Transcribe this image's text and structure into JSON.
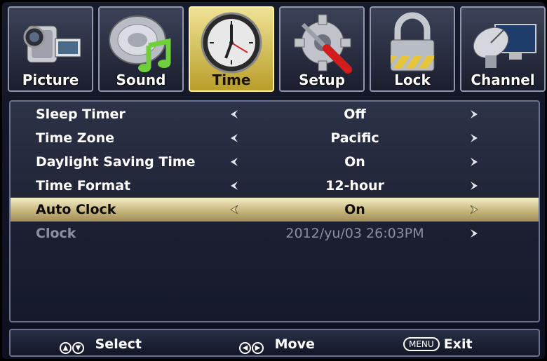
{
  "tabs": [
    {
      "label": "Picture",
      "icon": "camcorder-icon",
      "active": false
    },
    {
      "label": "Sound",
      "icon": "speaker-note-icon",
      "active": false
    },
    {
      "label": "Time",
      "icon": "clock-icon",
      "active": true
    },
    {
      "label": "Setup",
      "icon": "gear-wrench-icon",
      "active": false
    },
    {
      "label": "Lock",
      "icon": "padlock-icon",
      "active": false
    },
    {
      "label": "Channel",
      "icon": "satellite-dish-icon",
      "active": false
    }
  ],
  "menu": {
    "rows": [
      {
        "label": "Sleep Timer",
        "value": "Off",
        "state": "normal"
      },
      {
        "label": "Time Zone",
        "value": "Pacific",
        "state": "normal"
      },
      {
        "label": "Daylight Saving Time",
        "value": "On",
        "state": "normal"
      },
      {
        "label": "Time Format",
        "value": "12-hour",
        "state": "normal"
      },
      {
        "label": "Auto Clock",
        "value": "On",
        "state": "selected"
      },
      {
        "label": "Clock",
        "value": "2012/yu/03 26:03PM",
        "state": "disabled"
      }
    ]
  },
  "footer": {
    "select_label": "Select",
    "move_label": "Move",
    "menu_key": "MENU",
    "exit_label": "Exit"
  },
  "colors": {
    "selected_row": "#c7b67d",
    "active_tab": "#efe295",
    "background": "#151a2a"
  }
}
